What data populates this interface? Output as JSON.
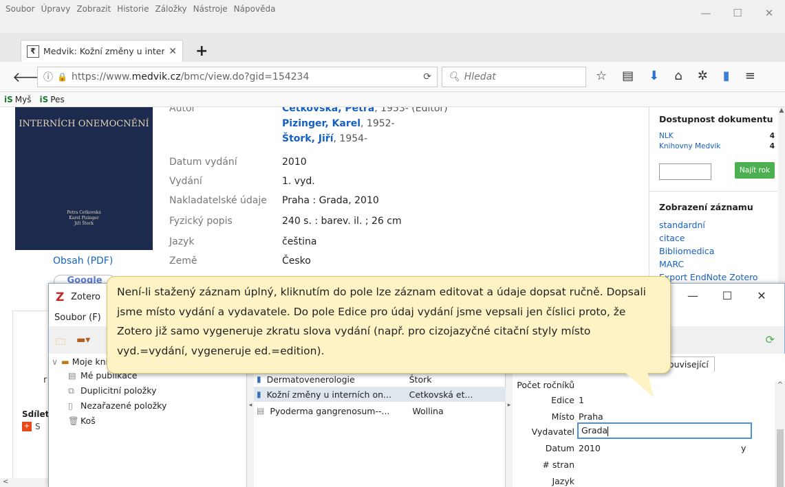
{
  "browser": {
    "menu": [
      "Soubor",
      "Úpravy",
      "Zobrazit",
      "Historie",
      "Záložky",
      "Nástroje",
      "Nápověda"
    ],
    "tab_title": "Medvik: Kožní změny u inter",
    "url_prefix": "https://www.",
    "url_domain": "medvik.cz",
    "url_path": "/bmc/view.do?gid=154234",
    "search_placeholder": "Hledat",
    "bookmarks": [
      "Myš",
      "Pes"
    ]
  },
  "book": {
    "cover_title": "INTERNÍCH ONEMOCNĚNÍ",
    "cover_authors": [
      "Petra Cetkovská",
      "Karel Pizinger",
      "Jiří Štork"
    ],
    "obsah_link": "Obsah (PDF)",
    "google_label": "Google"
  },
  "metadata": {
    "autor_label": "Autor",
    "authors": [
      {
        "name": "Cetkovská, Petra",
        "suffix": ", 1953- (Editor)"
      },
      {
        "name": "Pizinger, Karel",
        "suffix": ", 1952-"
      },
      {
        "name": "Štork, Jiří",
        "suffix": ", 1954-"
      }
    ],
    "rows": [
      {
        "label": "Datum vydání",
        "value": "2010"
      },
      {
        "label": "Vydání",
        "value": "1. vyd."
      },
      {
        "label": "Nakladatelské údaje",
        "value": "Praha : Grada, 2010"
      },
      {
        "label": "Fyzický popis",
        "value": "240 s. : barev. il. ; 26 cm"
      },
      {
        "label": "Jazyk",
        "value": "čeština"
      },
      {
        "label": "Země",
        "value": "Česko"
      }
    ]
  },
  "sidebar": {
    "dostupnost_title": "Dostupnost dokumentu",
    "libraries": [
      {
        "name": "NLK",
        "count": "4"
      },
      {
        "name": "Knihovny Medvik",
        "count": "4"
      }
    ],
    "find_year_button": "Najít rok",
    "zobrazeni_title": "Zobrazení záznamu",
    "formats": [
      "standardní",
      "citace",
      "Bibliomedica",
      "MARC",
      "Export EndNote Zotero"
    ]
  },
  "share": {
    "label": "Sdílet",
    "button_label": "S"
  },
  "zotero": {
    "title": "Zotero",
    "menu_file": "Soubor (F)",
    "collections": [
      {
        "label": "Moje knihovna",
        "icon": "folder"
      },
      {
        "label": "Mé publikace",
        "icon": "document"
      },
      {
        "label": "Duplicitní položky",
        "icon": "duplicate"
      },
      {
        "label": "Nezařazené položky",
        "icon": "unfiled"
      },
      {
        "label": "Koš",
        "icon": "trash"
      }
    ],
    "items": [
      {
        "title": "Dermatovenerologie",
        "author": "Štork"
      },
      {
        "title": "Kožní změny u interních on...",
        "author": "Cetkovská et..."
      },
      {
        "title": "Pyoderma gangrenosum--...",
        "author": "Wollina"
      }
    ],
    "related_tab": "Související",
    "fields": [
      {
        "label": "Počet ročníků",
        "value": ""
      },
      {
        "label": "Edice",
        "value": "1"
      },
      {
        "label": "Místo",
        "value": "Praha"
      },
      {
        "label": "Vydavatel",
        "value": "Grada"
      },
      {
        "label": "Datum",
        "value": "2010"
      },
      {
        "label": "# stran",
        "value": ""
      },
      {
        "label": "Jazyk",
        "value": ""
      }
    ],
    "date_suffix": "y"
  },
  "callout": {
    "text": "Není-li stažený záznam úplný, kliknutím do pole lze záznam editovat a údaje dopsat ručně. Dopsali jsme místo vydání a vydavatele. Do pole Edice pro údaj vydání jsme vepsali jen číslici proto, že Zotero již samo vygeneruje zkratu slova vydání (např. pro cizojazyčné citační styly místo vyd.=vydání, vygeneruje ed.=edition)."
  }
}
